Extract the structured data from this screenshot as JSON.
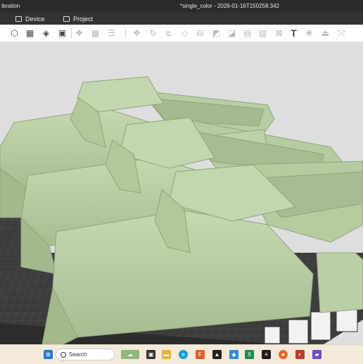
{
  "window": {
    "title_left": "ibration",
    "title_center": "*single_color - 2026-01-16T150258.342"
  },
  "tabs": [
    {
      "label": "Device",
      "icon": "monitor-icon"
    },
    {
      "label": "Project",
      "icon": "project-icon"
    }
  ],
  "toolbar": {
    "icons": [
      "add-object-icon",
      "grid-icon",
      "filament-icon",
      "plate-icon",
      "arrange-icon",
      "orient-icon",
      "layers-icon",
      "move-icon",
      "rotate-icon",
      "scale-icon",
      "eraser-icon",
      "cut-icon",
      "support-paint-icon",
      "seam-icon",
      "fuzzy-skin-icon",
      "text-icon",
      "assembly-icon",
      "measure-icon",
      "split-icon"
    ]
  },
  "taskbar": {
    "search_placeholder": "Search",
    "apps": [
      "windows-start-icon",
      "search-icon",
      "widgets-icon",
      "task-view-icon",
      "file-explorer-icon",
      "edge-icon",
      "app-icon",
      "app-icon",
      "store-icon",
      "excel-icon",
      "firefox-icon",
      "app-icon",
      "app-icon"
    ]
  },
  "colors": {
    "model": "#b6cda2",
    "bed": "#3a3a3a",
    "titlebar": "#2b2b2b",
    "taskbar": "#f3ead9"
  }
}
